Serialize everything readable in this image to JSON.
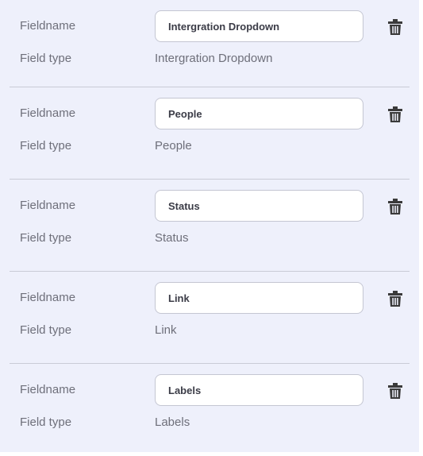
{
  "labels": {
    "fieldname": "Fieldname",
    "field_type": "Field type"
  },
  "delete_icon": "trash-icon",
  "colors": {
    "panel_background": "#eef0fb",
    "divider": "#c9cbd6",
    "icon": "#3a3a3a"
  },
  "fields": [
    {
      "name": "Intergration Dropdown",
      "type": "Intergration Dropdown"
    },
    {
      "name": "People",
      "type": "People"
    },
    {
      "name": "Status",
      "type": "Status"
    },
    {
      "name": "Link",
      "type": "Link"
    },
    {
      "name": "Labels",
      "type": "Labels"
    }
  ]
}
